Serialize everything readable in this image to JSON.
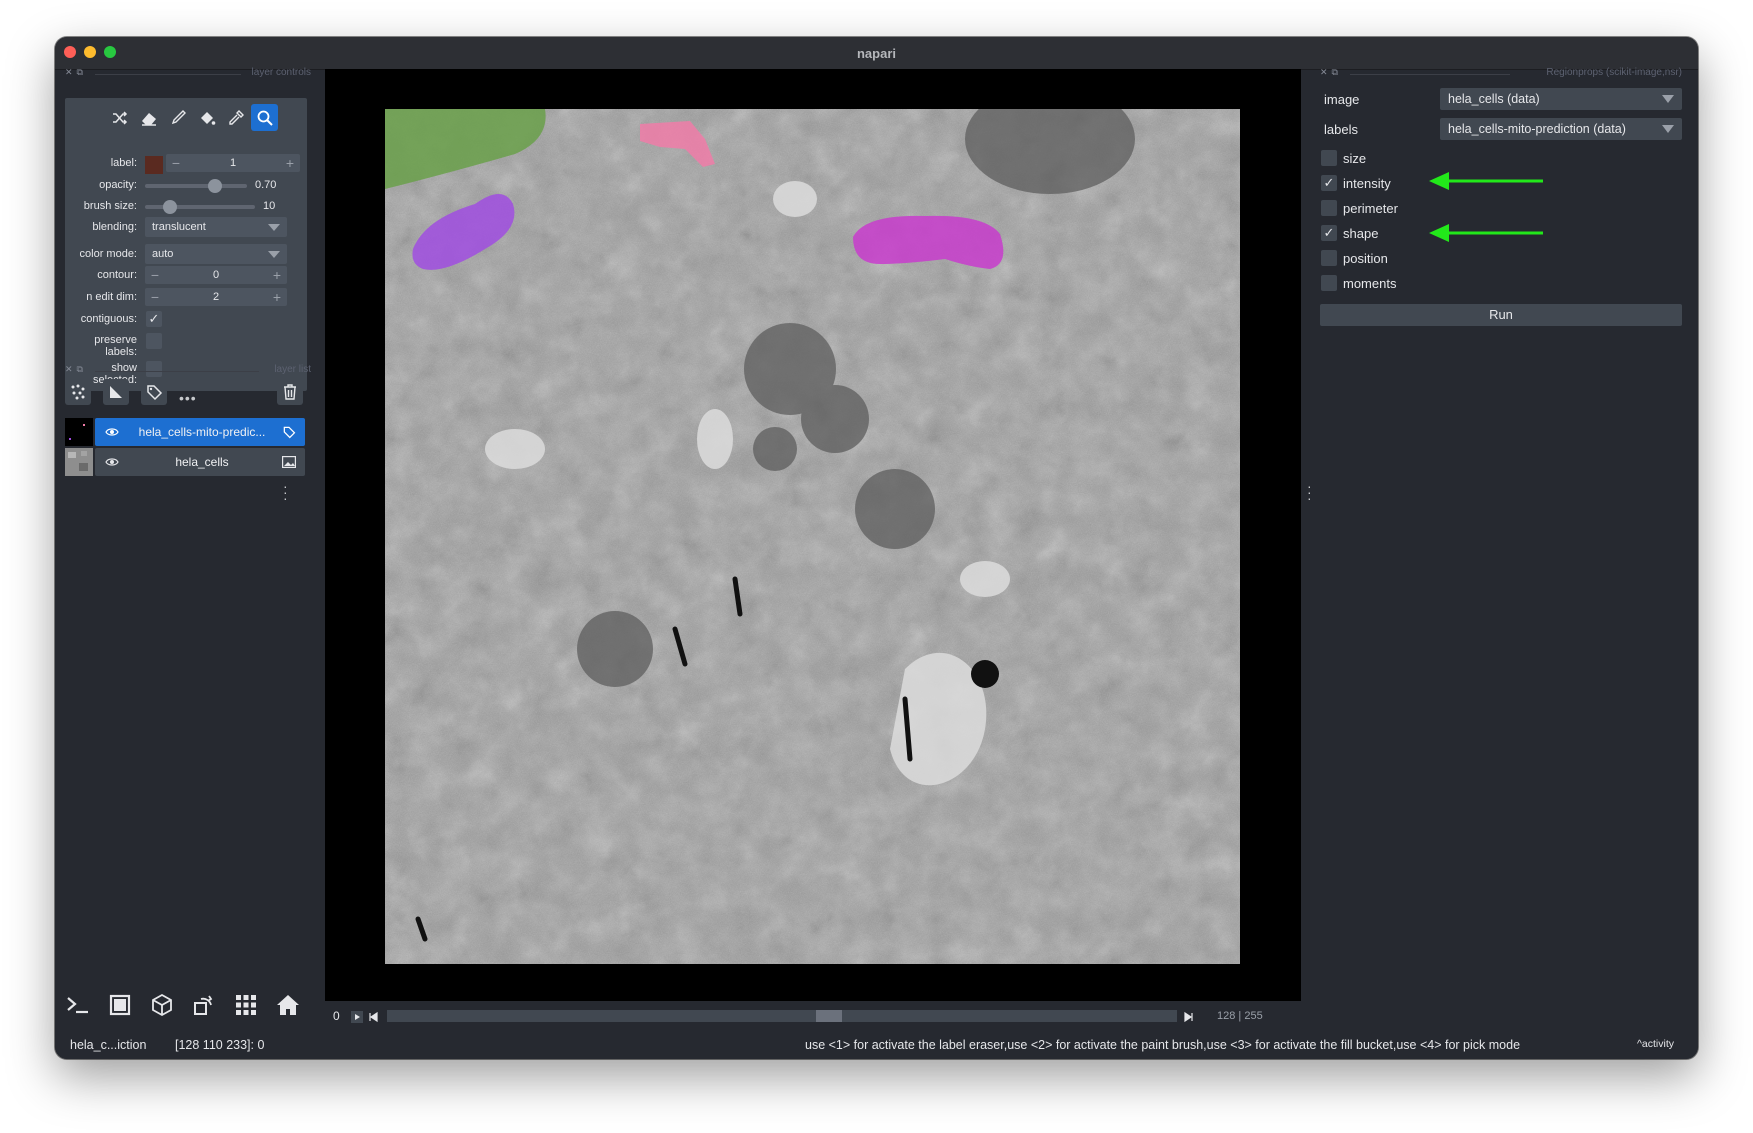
{
  "window": {
    "title": "napari"
  },
  "layer_controls": {
    "header": "layer controls",
    "tools": [
      {
        "name": "shuffle-colors-icon"
      },
      {
        "name": "eraser-icon"
      },
      {
        "name": "paint-brush-icon"
      },
      {
        "name": "fill-bucket-icon"
      },
      {
        "name": "color-picker-icon"
      },
      {
        "name": "zoom-icon",
        "active": true
      }
    ],
    "label": {
      "label": "label:",
      "value": "1",
      "color": "#5a2a20"
    },
    "opacity": {
      "label": "opacity:",
      "value": "0.70",
      "level": 0.7
    },
    "brush_size": {
      "label": "brush size:",
      "value": "10",
      "level": 0.2
    },
    "blending": {
      "label": "blending:",
      "value": "translucent"
    },
    "color_mode": {
      "label": "color mode:",
      "value": "auto"
    },
    "contour": {
      "label": "contour:",
      "value": "0"
    },
    "n_edit_dim": {
      "label": "n edit dim:",
      "value": "2"
    },
    "contiguous": {
      "label": "contiguous:",
      "checked": true
    },
    "preserve_labels": {
      "label1": "preserve",
      "label2": "labels:",
      "checked": false
    },
    "show_selected": {
      "label1": "show",
      "label2": "selected:",
      "checked": false
    }
  },
  "layer_list": {
    "header": "layer list",
    "layers": [
      {
        "name": "hela_cells-mito-predic...",
        "selected": true,
        "type_icon": "labels-icon"
      },
      {
        "name": "hela_cells",
        "selected": false,
        "type_icon": "image-icon"
      }
    ]
  },
  "dims": {
    "slider_label": "0",
    "position": "128",
    "total": "255"
  },
  "regionprops": {
    "header": "Regionprops (scikit-image,nsr)",
    "image_label": "image",
    "image_value": "hela_cells (data)",
    "labels_label": "labels",
    "labels_value": "hela_cells-mito-prediction (data)",
    "options": [
      {
        "label": "size",
        "checked": false
      },
      {
        "label": "intensity",
        "checked": true
      },
      {
        "label": "perimeter",
        "checked": false
      },
      {
        "label": "shape",
        "checked": true
      },
      {
        "label": "position",
        "checked": false
      },
      {
        "label": "moments",
        "checked": false
      }
    ],
    "run_label": "Run"
  },
  "annotations": {
    "arrow_color": "#22e81a"
  },
  "status_bar": {
    "layer": "hela_c...iction",
    "coords": "[128 110 233]: 0",
    "help": "use <1> for activate the label eraser,use <2> for activate the paint brush,use <3> for activate the fill bucket,use <4> for pick mode",
    "activity": "activity"
  },
  "colors": {
    "accent": "#1d6fd1",
    "panel_bg": "#262930",
    "widget_bg": "#414851",
    "label_green": "#6aa04a",
    "label_pink": "#f07ca8",
    "label_purple": "#a04de0",
    "label_magenta": "#c83ccd"
  }
}
